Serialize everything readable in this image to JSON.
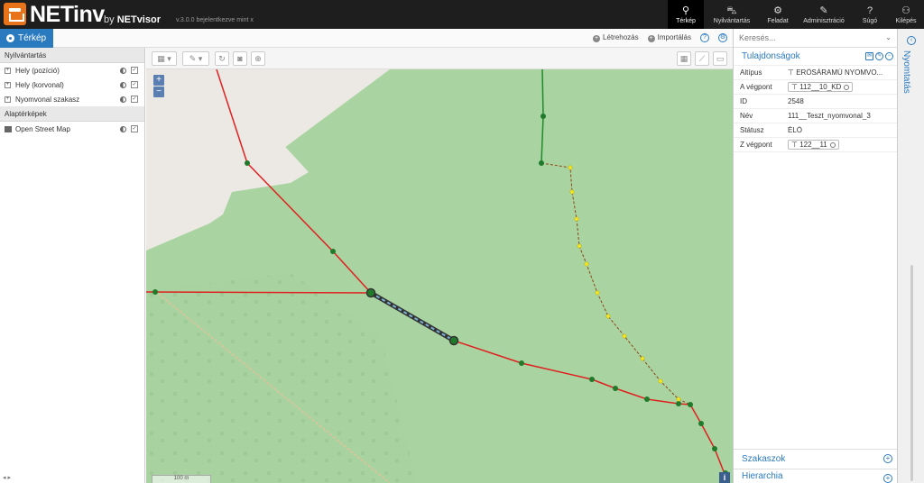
{
  "app": {
    "brand": "NETinv",
    "by": "by",
    "vendor": "NETvisor",
    "version": "v.3.0.0 bejelentkezve mint x"
  },
  "nav": [
    {
      "label": "Térkép",
      "icon": "map-pin-icon",
      "active": true
    },
    {
      "label": "Nyilvántartás",
      "icon": "car-icon",
      "active": false
    },
    {
      "label": "Feladat",
      "icon": "gear-icon",
      "active": false
    },
    {
      "label": "Adminisztráció",
      "icon": "wrench-icon",
      "active": false
    },
    {
      "label": "Súgó",
      "icon": "help-icon",
      "active": false
    },
    {
      "label": "Kilépés",
      "icon": "people-icon",
      "active": false
    }
  ],
  "subbar": {
    "tab": "Térkép",
    "create": "Létrehozás",
    "import": "Importálás"
  },
  "left": {
    "group1": "Nyilvántartás",
    "layers": [
      "Hely (pozíció)",
      "Hely (korvonal)",
      "Nyomvonal szakasz"
    ],
    "group2": "Alaptérképek",
    "basemap": "Open Street Map"
  },
  "map": {
    "scale": "100 m",
    "info": "i"
  },
  "right": {
    "search_placeholder": "Keresés...",
    "props_title": "Tulajdonságok",
    "props": [
      {
        "k": "Altípus",
        "v": "ERŐSÁRAMÚ NYOMVO..."
      },
      {
        "k": "A végpont",
        "v": "112__10_KD"
      },
      {
        "k": "ID",
        "v": "2548"
      },
      {
        "k": "Név",
        "v": "111__Teszt_nyomvonal_3"
      },
      {
        "k": "Státusz",
        "v": "ÉLŐ"
      },
      {
        "k": "Z végpont",
        "v": "122__11"
      }
    ],
    "sec1": "Szakaszok",
    "sec2": "Hierarchia"
  },
  "strip": {
    "label": "Nyomtatás"
  },
  "colors": {
    "accent": "#2a7abf",
    "topbar": "#1e1e1e",
    "map_green": "#a8d3a0",
    "line_red": "#e02020",
    "node_green": "#1f7a2a"
  }
}
